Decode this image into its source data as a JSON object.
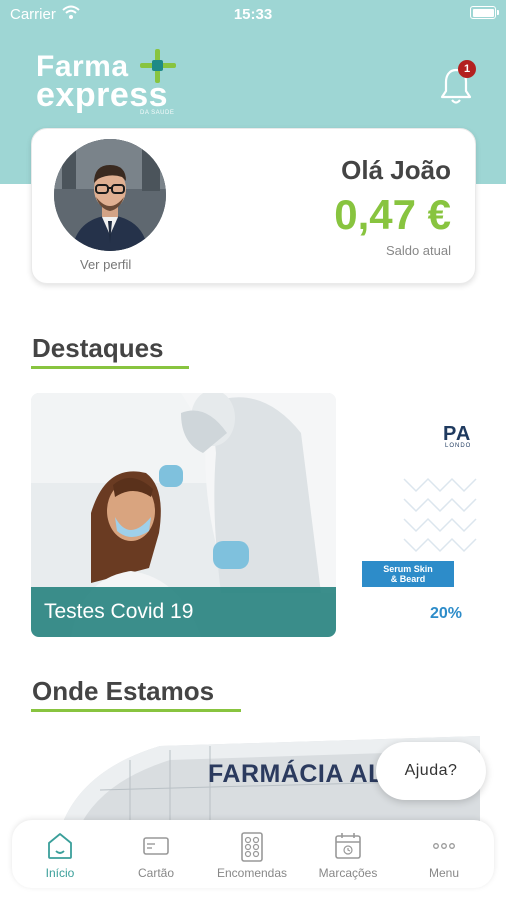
{
  "status_bar": {
    "carrier": "Carrier",
    "time": "15:33"
  },
  "logo": {
    "line1": "Farma",
    "line2": "express",
    "tagline": "DA SAÚDE"
  },
  "notifications": {
    "count": "1"
  },
  "profile": {
    "view_profile": "Ver perfil",
    "greeting": "Olá João",
    "balance": "0,47 €",
    "balance_label": "Saldo atual"
  },
  "highlights": {
    "title": "Destaques",
    "cards": [
      {
        "caption": "Testes Covid 19"
      },
      {
        "brand": "PA",
        "brand_sub": "LONDO",
        "tag_line1": "Serum Skin",
        "tag_line2": "& Beard",
        "discount": "20%"
      }
    ]
  },
  "locations": {
    "title": "Onde Estamos",
    "store_sign": "FARMÁCIA AL"
  },
  "help": {
    "label": "Ajuda?"
  },
  "tabs": [
    {
      "label": "Início",
      "icon": "home-icon",
      "active": true
    },
    {
      "label": "Cartão",
      "icon": "card-icon",
      "active": false
    },
    {
      "label": "Encomendas",
      "icon": "pills-icon",
      "active": false
    },
    {
      "label": "Marcações",
      "icon": "calendar-icon",
      "active": false
    },
    {
      "label": "Menu",
      "icon": "more-icon",
      "active": false
    }
  ],
  "colors": {
    "header": "#9ed6d4",
    "accent_green": "#88c43f",
    "teal": "#3a9f9a",
    "badge_red": "#b3201f"
  }
}
